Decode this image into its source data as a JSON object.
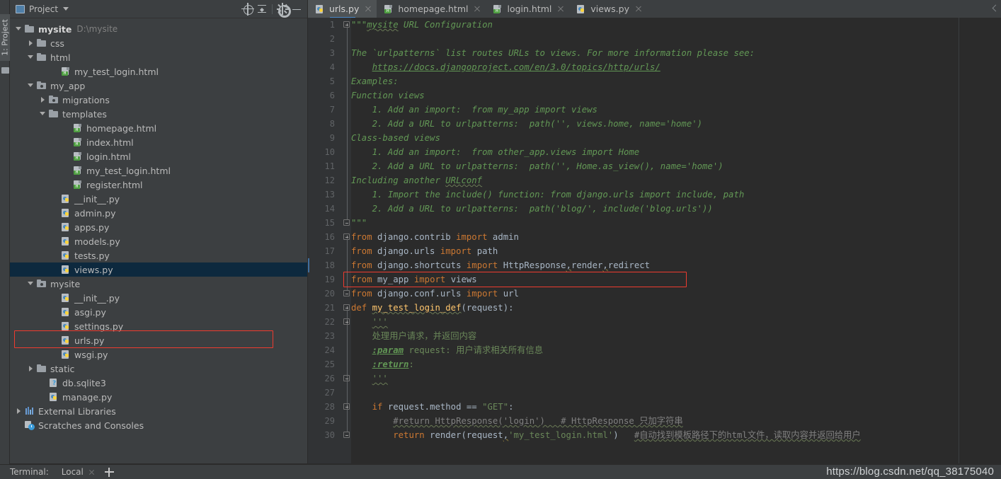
{
  "window": {
    "toolstrip_label": "1: Project"
  },
  "project_panel": {
    "title": "Project",
    "caret": "chevron-down-icon",
    "tools": [
      {
        "name": "locate-icon",
        "label": "Select Opened File"
      },
      {
        "name": "collapse-all-icon",
        "label": "Collapse All"
      },
      {
        "name": "gear-icon",
        "label": "Settings"
      },
      {
        "name": "minimize-icon",
        "label": "Hide"
      }
    ],
    "tree": [
      {
        "label": "mysite",
        "path": "D:\\mysite",
        "icon": "folder-icon",
        "indent": 0,
        "arrow": "down",
        "bold": true,
        "selected": false
      },
      {
        "label": "css",
        "path": "",
        "icon": "folder-icon",
        "indent": 1,
        "arrow": "right",
        "bold": false,
        "selected": false
      },
      {
        "label": "html",
        "path": "",
        "icon": "folder-icon",
        "indent": 1,
        "arrow": "down",
        "bold": false,
        "selected": false
      },
      {
        "label": "my_test_login.html",
        "path": "",
        "icon": "html-file-icon",
        "indent": 3,
        "arrow": "none",
        "bold": false,
        "selected": false
      },
      {
        "label": "my_app",
        "path": "",
        "icon": "module-folder-icon",
        "indent": 1,
        "arrow": "down",
        "bold": false,
        "selected": false
      },
      {
        "label": "migrations",
        "path": "",
        "icon": "module-folder-icon",
        "indent": 2,
        "arrow": "right",
        "bold": false,
        "selected": false
      },
      {
        "label": "templates",
        "path": "",
        "icon": "folder-icon",
        "indent": 2,
        "arrow": "down",
        "bold": false,
        "selected": false
      },
      {
        "label": "homepage.html",
        "path": "",
        "icon": "html-file-icon",
        "indent": 4,
        "arrow": "none",
        "bold": false,
        "selected": false
      },
      {
        "label": "index.html",
        "path": "",
        "icon": "html-file-icon",
        "indent": 4,
        "arrow": "none",
        "bold": false,
        "selected": false
      },
      {
        "label": "login.html",
        "path": "",
        "icon": "html-file-icon",
        "indent": 4,
        "arrow": "none",
        "bold": false,
        "selected": false
      },
      {
        "label": "my_test_login.html",
        "path": "",
        "icon": "html-file-icon",
        "indent": 4,
        "arrow": "none",
        "bold": false,
        "selected": false
      },
      {
        "label": "register.html",
        "path": "",
        "icon": "html-file-icon",
        "indent": 4,
        "arrow": "none",
        "bold": false,
        "selected": false
      },
      {
        "label": "__init__.py",
        "path": "",
        "icon": "python-file-icon",
        "indent": 3,
        "arrow": "none",
        "bold": false,
        "selected": false
      },
      {
        "label": "admin.py",
        "path": "",
        "icon": "python-file-icon",
        "indent": 3,
        "arrow": "none",
        "bold": false,
        "selected": false
      },
      {
        "label": "apps.py",
        "path": "",
        "icon": "python-file-icon",
        "indent": 3,
        "arrow": "none",
        "bold": false,
        "selected": false
      },
      {
        "label": "models.py",
        "path": "",
        "icon": "python-file-icon",
        "indent": 3,
        "arrow": "none",
        "bold": false,
        "selected": false
      },
      {
        "label": "tests.py",
        "path": "",
        "icon": "python-file-icon",
        "indent": 3,
        "arrow": "none",
        "bold": false,
        "selected": false
      },
      {
        "label": "views.py",
        "path": "",
        "icon": "python-file-icon",
        "indent": 3,
        "arrow": "none",
        "bold": false,
        "selected": true
      },
      {
        "label": "mysite",
        "path": "",
        "icon": "module-folder-icon",
        "indent": 1,
        "arrow": "down",
        "bold": false,
        "selected": false
      },
      {
        "label": "__init__.py",
        "path": "",
        "icon": "python-file-icon",
        "indent": 3,
        "arrow": "none",
        "bold": false,
        "selected": false
      },
      {
        "label": "asgi.py",
        "path": "",
        "icon": "python-file-icon",
        "indent": 3,
        "arrow": "none",
        "bold": false,
        "selected": false
      },
      {
        "label": "settings.py",
        "path": "",
        "icon": "python-file-icon",
        "indent": 3,
        "arrow": "none",
        "bold": false,
        "selected": false
      },
      {
        "label": "urls.py",
        "path": "",
        "icon": "python-file-icon",
        "indent": 3,
        "arrow": "none",
        "bold": false,
        "selected": false
      },
      {
        "label": "wsgi.py",
        "path": "",
        "icon": "python-file-icon",
        "indent": 3,
        "arrow": "none",
        "bold": false,
        "selected": false
      },
      {
        "label": "static",
        "path": "",
        "icon": "folder-icon",
        "indent": 1,
        "arrow": "right",
        "bold": false,
        "selected": false
      },
      {
        "label": "db.sqlite3",
        "path": "",
        "icon": "db-file-icon",
        "indent": 2,
        "arrow": "none",
        "bold": false,
        "selected": false
      },
      {
        "label": "manage.py",
        "path": "",
        "icon": "python-file-icon",
        "indent": 2,
        "arrow": "none",
        "bold": false,
        "selected": false
      },
      {
        "label": "External Libraries",
        "path": "",
        "icon": "library-icon",
        "indent": 0,
        "arrow": "right",
        "bold": false,
        "selected": false
      },
      {
        "label": "Scratches and Consoles",
        "path": "",
        "icon": "scratches-icon",
        "indent": 0,
        "arrow": "none",
        "bold": false,
        "selected": false
      }
    ],
    "annotation_highlight_row": "urls.py"
  },
  "editor": {
    "tabs": [
      {
        "label": "urls.py",
        "icon": "python-file-icon",
        "active": true
      },
      {
        "label": "homepage.html",
        "icon": "html-file-icon",
        "active": false
      },
      {
        "label": "login.html",
        "icon": "html-file-icon",
        "active": false
      },
      {
        "label": "views.py",
        "icon": "python-file-icon",
        "active": false
      }
    ],
    "annotation_highlight_line": 19,
    "line_numbers": [
      1,
      2,
      3,
      4,
      5,
      6,
      7,
      8,
      9,
      10,
      11,
      12,
      13,
      14,
      15,
      16,
      17,
      18,
      19,
      20,
      21,
      22,
      23,
      24,
      25,
      26,
      27,
      28,
      29,
      30
    ],
    "lines": [
      {
        "n": 1,
        "text": "\"\"\"mysite URL Configuration"
      },
      {
        "n": 2,
        "text": ""
      },
      {
        "n": 3,
        "text": "The `urlpatterns` list routes URLs to views. For more information please see:"
      },
      {
        "n": 4,
        "text": "    https://docs.djangoproject.com/en/3.0/topics/http/urls/"
      },
      {
        "n": 5,
        "text": "Examples:"
      },
      {
        "n": 6,
        "text": "Function views"
      },
      {
        "n": 7,
        "text": "    1. Add an import:  from my_app import views"
      },
      {
        "n": 8,
        "text": "    2. Add a URL to urlpatterns:  path('', views.home, name='home')"
      },
      {
        "n": 9,
        "text": "Class-based views"
      },
      {
        "n": 10,
        "text": "    1. Add an import:  from other_app.views import Home"
      },
      {
        "n": 11,
        "text": "    2. Add a URL to urlpatterns:  path('', Home.as_view(), name='home')"
      },
      {
        "n": 12,
        "text": "Including another URLconf"
      },
      {
        "n": 13,
        "text": "    1. Import the include() function: from django.urls import include, path"
      },
      {
        "n": 14,
        "text": "    2. Add a URL to urlpatterns:  path('blog/', include('blog.urls'))"
      },
      {
        "n": 15,
        "text": "\"\"\""
      },
      {
        "n": 16,
        "text": "from django.contrib import admin"
      },
      {
        "n": 17,
        "text": "from django.urls import path"
      },
      {
        "n": 18,
        "text": "from django.shortcuts import HttpResponse,render,redirect"
      },
      {
        "n": 19,
        "text": "from my_app import views"
      },
      {
        "n": 20,
        "text": "from django.conf.urls import url"
      },
      {
        "n": 21,
        "text": "def my_test_login_def(request):"
      },
      {
        "n": 22,
        "text": "    '''"
      },
      {
        "n": 23,
        "text": "    处理用户请求，并返回内容"
      },
      {
        "n": 24,
        "text": "    :param request: 用户请求相关所有信息"
      },
      {
        "n": 25,
        "text": "    :return:"
      },
      {
        "n": 26,
        "text": "    '''"
      },
      {
        "n": 27,
        "text": ""
      },
      {
        "n": 28,
        "text": "    if request.method == \"GET\":"
      },
      {
        "n": 29,
        "text": "        #return HttpResponse('login')   # HttpResponse 只加字符串"
      },
      {
        "n": 30,
        "text": "        return render(request,'my_test_login.html')   #自动找到模板路径下的html文件，读取内容并返回给用户"
      }
    ]
  },
  "status_bar": {
    "terminal_label": "Terminal:",
    "local_label": "Local",
    "close_icon": "close-icon",
    "add_icon": "plus-icon"
  },
  "watermark": {
    "text": "https://blog.csdn.net/qq_38175040"
  },
  "colors": {
    "panel_bg": "#3c3f41",
    "editor_bg": "#2b2b2b",
    "gutter_bg": "#313335",
    "selection": "#0d293e",
    "annotation_red": "#ee3b2f",
    "accent_blue": "#4a88c7",
    "keyword_orange": "#cc7832",
    "string_green": "#6a8759",
    "docstring_green": "#629755",
    "function_yellow": "#ffc66d",
    "comment_grey": "#808080"
  }
}
